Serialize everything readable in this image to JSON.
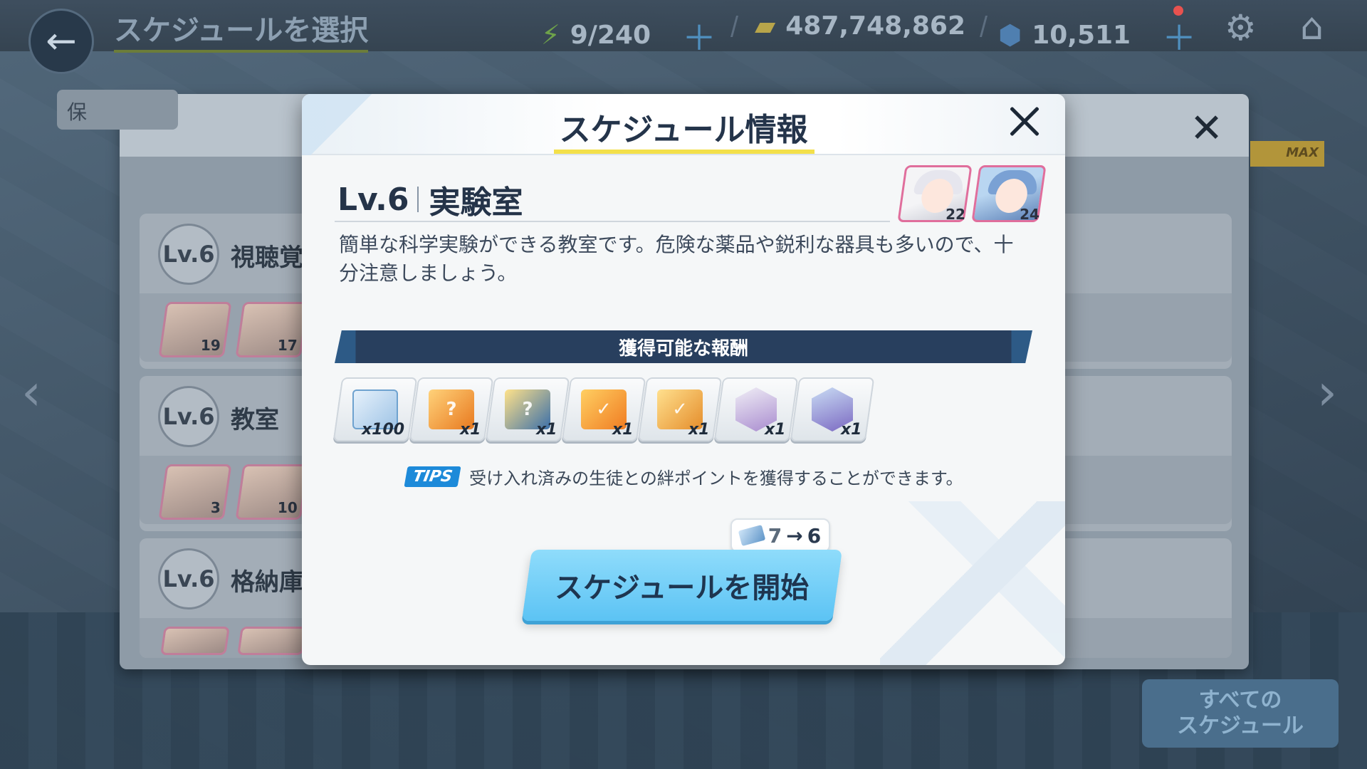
{
  "topbar": {
    "title": "スケジュールを選択",
    "ap": "9/240",
    "credits": "487,748,862",
    "gems": "10,511"
  },
  "back_panel": {
    "items": [
      {
        "level": "Lv.6",
        "name": "視聴覚",
        "affinity": [
          "19",
          "17"
        ]
      },
      {
        "level": "Lv.6",
        "name": "教室",
        "affinity": [
          "3",
          "10"
        ]
      },
      {
        "level": "Lv.6",
        "name": "格納庫",
        "affinity": []
      }
    ],
    "chip": "保",
    "max_label": "MAX",
    "all_schedules_line1": "すべての",
    "all_schedules_line2": "スケジュール"
  },
  "modal": {
    "title": "スケジュール情報",
    "level": "Lv.6",
    "room": "実験室",
    "description": "簡単な科学実験ができる教室です。危険な薬品や鋭利な器具も多いので、十分注意しましょう。",
    "students": [
      {
        "affinity": "22"
      },
      {
        "affinity": "24"
      }
    ],
    "rewards_heading": "獲得可能な報酬",
    "rewards": [
      {
        "type": "exp-ticket",
        "qty": "x100"
      },
      {
        "type": "mystery-box",
        "qty": "x1"
      },
      {
        "type": "gift-box",
        "qty": "x1"
      },
      {
        "type": "ex-box",
        "qty": "x1"
      },
      {
        "type": "check-box",
        "qty": "x1"
      },
      {
        "type": "student-hex",
        "qty": "x1"
      },
      {
        "type": "student-hex",
        "qty": "x1"
      }
    ],
    "tips_tag": "TIPS",
    "tips_text": "受け入れ済みの生徒との絆ポイントを獲得することができます。",
    "cost_from": "7",
    "cost_to": "6",
    "start_label": "スケジュールを開始"
  },
  "colors": {
    "accent_yellow": "#f3e04a",
    "button_blue": "#5cc3f4",
    "reward_bar": "#283f5e",
    "tips_blue": "#1d8ad9",
    "affinity_pink": "#e06e9c"
  }
}
